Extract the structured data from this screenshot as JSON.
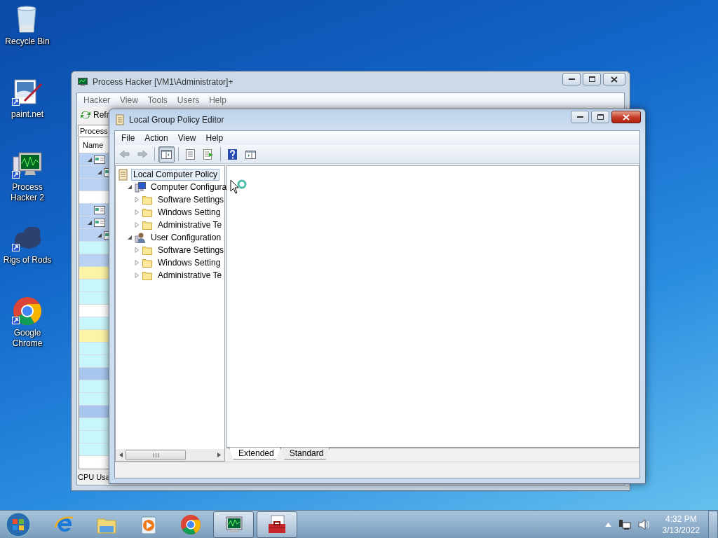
{
  "desktop_icons": [
    {
      "label": "Recycle Bin",
      "kind": "recycle",
      "shortcut": false
    },
    {
      "label": "paint.net",
      "kind": "paint",
      "shortcut": true
    },
    {
      "label": "Process Hacker 2",
      "kind": "monitor",
      "shortcut": true
    },
    {
      "label": "Rigs of Rods",
      "kind": "blob",
      "shortcut": true
    },
    {
      "label": "Google Chrome",
      "kind": "chrome",
      "shortcut": true
    }
  ],
  "back_window": {
    "title": "Process Hacker [VM1\\Administrator]+",
    "menu": [
      "Hacker",
      "View",
      "Tools",
      "Users",
      "Help"
    ],
    "toolbar_button": "Refr",
    "tab": "Process",
    "column": "Name",
    "status": "CPU Usa",
    "rows": [
      {
        "color": "#b9d1f2",
        "expanded": true,
        "children": [
          {
            "color": "#b9d1f2",
            "expanded": true,
            "children": [
              {
                "color": "#b9d1f2",
                "expanded": false
              },
              {
                "color": "#ffffff",
                "expanded": false
              }
            ]
          }
        ]
      },
      {
        "color": "#b9d1f2",
        "expanded": false
      },
      {
        "color": "#b9d1f2",
        "expanded": true,
        "children": [
          {
            "color": "#b9d1f2",
            "expanded": true,
            "children": [
              {
                "color": "#c9f6fa",
                "expanded": false
              },
              {
                "color": "#b9d1f2",
                "expanded": false
              },
              {
                "color": "#fbf3a6",
                "expanded": false
              },
              {
                "color": "#c9f6fa",
                "expanded": false
              },
              {
                "color": "#c9f6fa",
                "expanded": false
              },
              {
                "color": "#ffffff",
                "expanded": false
              },
              {
                "color": "#c9f6fa",
                "expanded": false
              },
              {
                "color": "#fbf3a6",
                "expanded": false
              },
              {
                "color": "#c9f6fa",
                "expanded": false
              },
              {
                "color": "#c9f6fa",
                "expanded": false
              },
              {
                "color": "#a9c6ef",
                "expanded": false
              },
              {
                "color": "#c9f6fa",
                "expanded": false
              },
              {
                "color": "#c9f6fa",
                "expanded": false
              },
              {
                "color": "#a9c6ef",
                "expanded": false
              },
              {
                "color": "#c9f6fa",
                "expanded": false
              },
              {
                "color": "#c9f6fa",
                "expanded": false
              },
              {
                "color": "#c9f6fa",
                "expanded": false
              }
            ]
          }
        ]
      }
    ]
  },
  "front_window": {
    "title": "Local Group Policy Editor",
    "menu": [
      "File",
      "Action",
      "View",
      "Help"
    ],
    "toolbar": [
      {
        "kind": "back",
        "disabled": true,
        "pressed": false
      },
      {
        "kind": "forward",
        "disabled": true,
        "pressed": false
      },
      {
        "kind": "separator"
      },
      {
        "kind": "tree",
        "disabled": false,
        "pressed": true
      },
      {
        "kind": "separator"
      },
      {
        "kind": "properties",
        "disabled": false,
        "pressed": false
      },
      {
        "kind": "export",
        "disabled": false,
        "pressed": false
      },
      {
        "kind": "separator"
      },
      {
        "kind": "help",
        "disabled": false,
        "pressed": false
      },
      {
        "kind": "actionpane",
        "disabled": false,
        "pressed": false
      }
    ],
    "tree": [
      {
        "label": "Local Computer Policy",
        "kind": "policy",
        "selected": true,
        "children": [
          {
            "label": "Computer Configura",
            "kind": "computer",
            "selected": false,
            "expanded": true,
            "children": [
              {
                "label": "Software Settings",
                "kind": "folder",
                "selected": false,
                "expanded": false
              },
              {
                "label": "Windows Setting",
                "kind": "folder",
                "selected": false,
                "expanded": false
              },
              {
                "label": "Administrative Te",
                "kind": "folder",
                "selected": false,
                "expanded": false
              }
            ]
          },
          {
            "label": "User Configuration",
            "kind": "user",
            "selected": false,
            "expanded": true,
            "children": [
              {
                "label": "Software Settings",
                "kind": "folder",
                "selected": false,
                "expanded": false
              },
              {
                "label": "Windows Setting",
                "kind": "folder",
                "selected": false,
                "expanded": false
              },
              {
                "label": "Administrative Te",
                "kind": "folder",
                "selected": false,
                "expanded": false
              }
            ]
          }
        ]
      }
    ],
    "tabs": [
      {
        "label": "Extended",
        "selected": true
      },
      {
        "label": "Standard",
        "selected": false
      }
    ]
  },
  "taskbar": {
    "items": [
      {
        "kind": "ie",
        "open": false
      },
      {
        "kind": "explorer",
        "open": false
      },
      {
        "kind": "media",
        "open": false
      },
      {
        "kind": "chrome",
        "open": false
      },
      {
        "kind": "monitor",
        "open": true
      },
      {
        "kind": "toolbox",
        "open": true
      }
    ],
    "time": "4:32 PM",
    "date": "3/13/2022"
  }
}
